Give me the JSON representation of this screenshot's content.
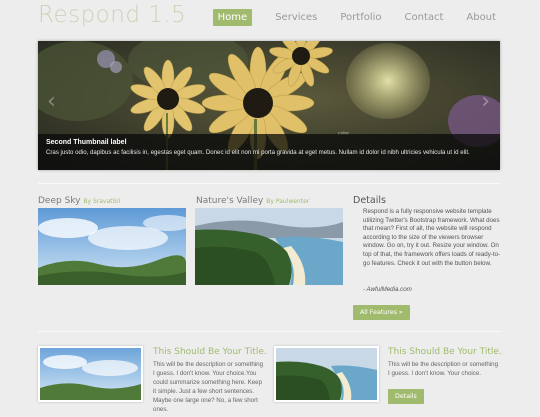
{
  "brand": {
    "logo": "Respond 1.5"
  },
  "nav": {
    "items": [
      "Home",
      "Services",
      "Portfolio",
      "Contact",
      "About"
    ],
    "active_index": 0
  },
  "carousel": {
    "prev_glyph": "‹",
    "next_glyph": "›",
    "photo_tag": "color",
    "caption_title": "Second Thumbnail label",
    "caption_text": "Cras justo odio, dapibus ac facilisis in, egestas eget quam. Donec id elit non mi porta gravida at eget metus. Nullam id dolor id nibh ultricies vehicula ut id elit."
  },
  "features": [
    {
      "title": "Deep Sky",
      "byline": "By SravatSri"
    },
    {
      "title": "Nature's Valley",
      "byline": "By Paulwenter"
    }
  ],
  "details": {
    "title": "Details",
    "text": "Respond is a fully responsive website template utilizing Twitter's Bootstrap framework. What does that mean? First of all, the website will respond according to the size of the viewers browser window. Go on, try it out. Resize your window. On top of that, the framework offers loads of ready-to-go features. Check it out with the button below.",
    "credit": "- AwfulMedia.com",
    "button": "All Features »"
  },
  "cards": [
    {
      "title": "This Should Be Your Title.",
      "text": "This will be the description or something I guess. I don't know. Your choice.You could summarize something here. Keep it simple. Just a few short sentences. Maybe one large one? No, a few short ones."
    },
    {
      "title": "This Should Be Your Title.",
      "text": "This will be the description or something I guess. I don't know. Your choice.",
      "button": "Details"
    }
  ],
  "colors": {
    "accent": "#a1bb6e",
    "background": "#ededed"
  }
}
